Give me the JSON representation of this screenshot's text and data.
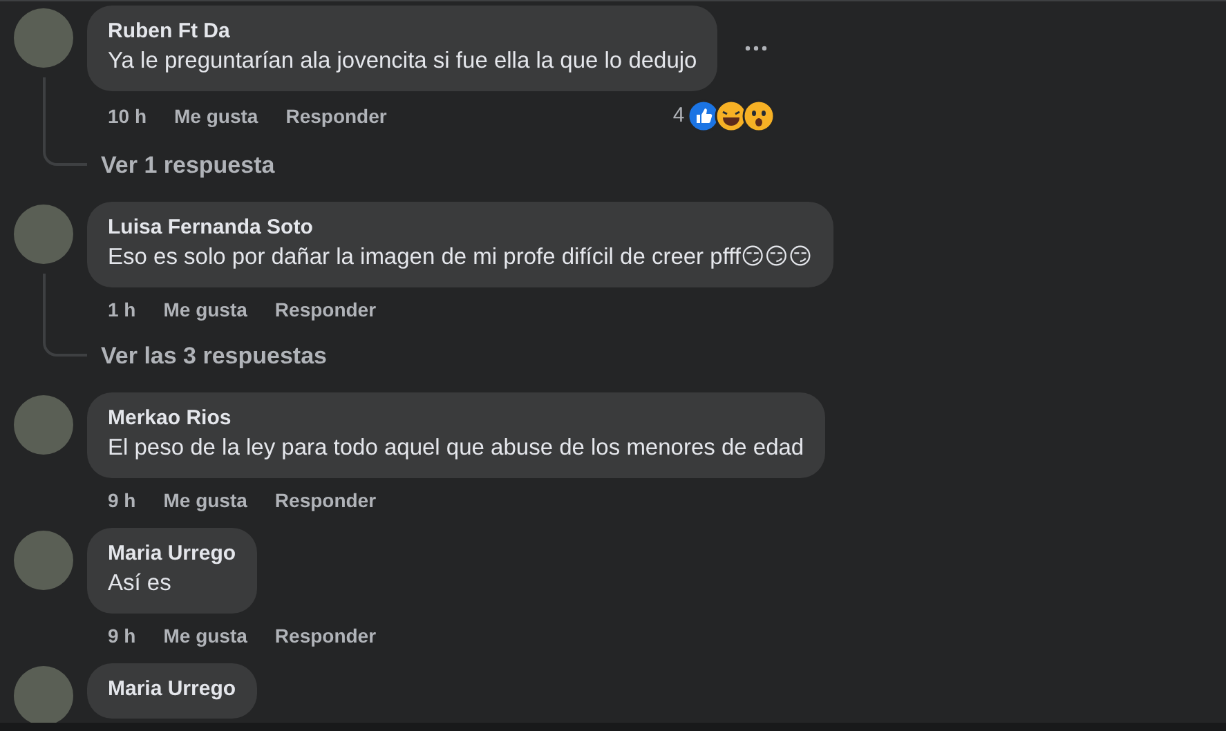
{
  "comments": [
    {
      "author": "Ruben Ft Da",
      "text": "Ya le preguntarían ala jovencita si fue ella la que lo dedujo",
      "time": "10 h",
      "like_label": "Me gusta",
      "reply_label": "Responder",
      "reactions": {
        "count": "4",
        "items": [
          {
            "kind": "like"
          },
          {
            "kind": "haha"
          },
          {
            "kind": "wow"
          }
        ]
      },
      "more_button": true,
      "replies_link": "Ver 1 respuesta"
    },
    {
      "author": "Luisa Fernanda Soto",
      "text": "Eso es solo por dañar la imagen de mi profe difícil de creer pfff😏😏😏",
      "time": "1 h",
      "like_label": "Me gusta",
      "reply_label": "Responder",
      "replies_link": "Ver las 3 respuestas"
    },
    {
      "author": "Merkao Rios",
      "text": "El peso de la ley para todo aquel que abuse de los menores de edad",
      "time": "9 h",
      "like_label": "Me gusta",
      "reply_label": "Responder"
    },
    {
      "author": "Maria Urrego",
      "text": "Así es",
      "time": "9 h",
      "like_label": "Me gusta",
      "reply_label": "Responder"
    },
    {
      "author": "Maria Urrego"
    }
  ]
}
